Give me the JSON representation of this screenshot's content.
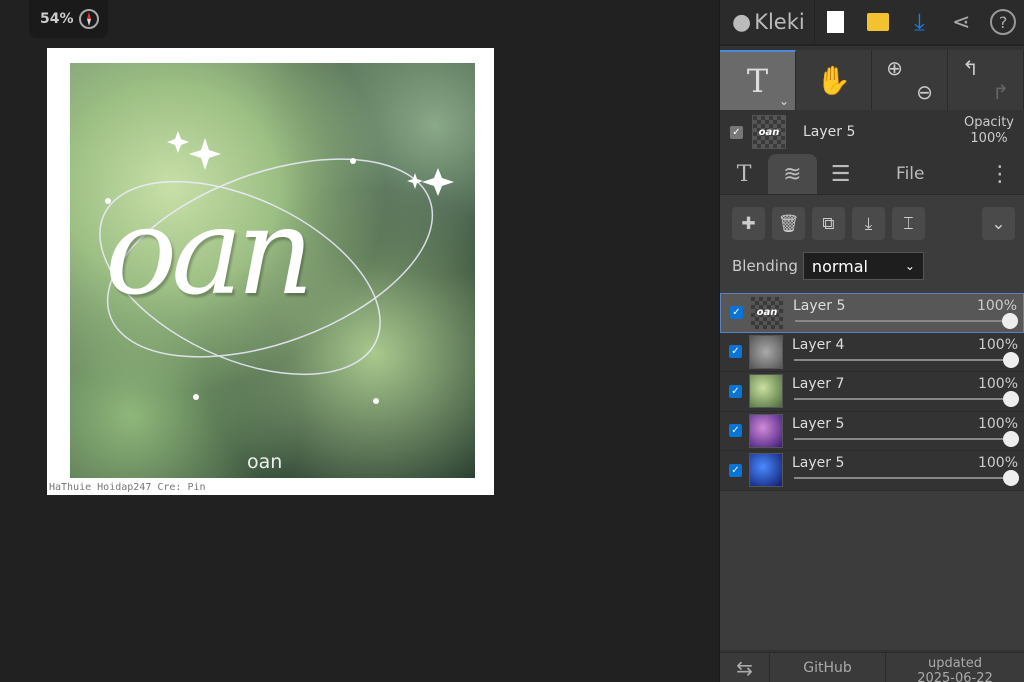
{
  "zoom": {
    "level": "54%"
  },
  "canvas": {
    "art_text": "oan",
    "small_text": "oan",
    "credit": "HaThuie  Hoidap247  Cre: Pin"
  },
  "topbar": {
    "logo": "Kleki"
  },
  "current_layer": {
    "name": "Layer 5",
    "opacity_label": "Opacity",
    "opacity": "100%",
    "thumb_text": "oan"
  },
  "tabs": {
    "file": "File"
  },
  "blending": {
    "label": "Blending",
    "value": "normal"
  },
  "layers": [
    {
      "name": "Layer 5",
      "opacity": "100%",
      "thumb_text": "oan",
      "thumb": "linear-gradient(#444,#444)"
    },
    {
      "name": "Layer 4",
      "opacity": "100%",
      "thumb_text": "",
      "thumb": "radial-gradient(#aaa,#555)"
    },
    {
      "name": "Layer 7",
      "opacity": "100%",
      "thumb_text": "",
      "thumb": "radial-gradient(circle at 40% 40%,#c9e0a0,#4a6a3a)"
    },
    {
      "name": "Layer 5",
      "opacity": "100%",
      "thumb_text": "",
      "thumb": "radial-gradient(circle at 40% 40%,#d28ad8,#3a1a7a)"
    },
    {
      "name": "Layer 5",
      "opacity": "100%",
      "thumb_text": "",
      "thumb": "radial-gradient(circle at 40% 40%,#4a8aff,#101a6a)"
    }
  ],
  "footer": {
    "github": "GitHub",
    "updated": "updated",
    "date": "2025-06-22"
  },
  "colors": {
    "accent": "#0a73d6",
    "download": "#1a7ee8",
    "folder": "#f2c230"
  }
}
